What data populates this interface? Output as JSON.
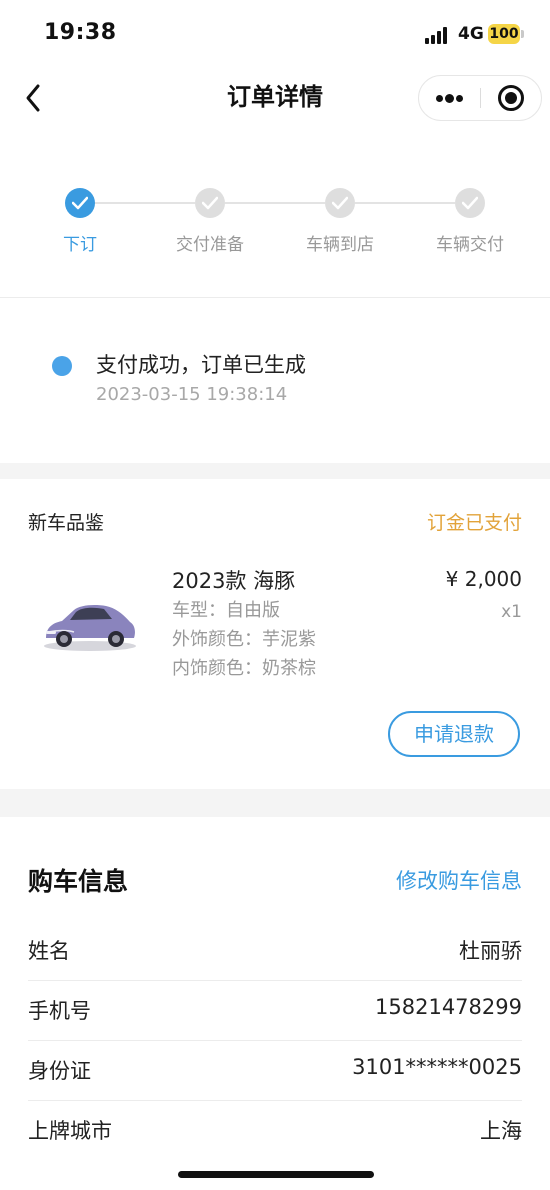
{
  "status_bar": {
    "time": "19:38",
    "network": "4G",
    "battery": "100"
  },
  "nav": {
    "title": "订单详情",
    "back_icon": "chevron-left-icon",
    "more_icon": "more-dots-icon",
    "close_icon": "target-close-icon"
  },
  "steps": [
    {
      "label": "下订",
      "state": "done"
    },
    {
      "label": "交付准备",
      "state": "pending"
    },
    {
      "label": "车辆到店",
      "state": "pending"
    },
    {
      "label": "车辆交付",
      "state": "pending"
    }
  ],
  "order_status": {
    "text": "支付成功，订单已生成",
    "time": "2023-03-15 19:38:14"
  },
  "order_card": {
    "title": "新车品鉴",
    "status": "订金已支付",
    "product_name": "2023款 海豚",
    "model": "车型：自由版",
    "exterior": "外饰颜色：芋泥紫",
    "interior": "内饰颜色：奶茶棕",
    "price": "¥ 2,000",
    "quantity": "x1",
    "refund_button": "申请退款"
  },
  "purchase_info": {
    "title": "购车信息",
    "edit_link": "修改购车信息",
    "rows": [
      {
        "label": "姓名",
        "value": "杜丽骄"
      },
      {
        "label": "手机号",
        "value": "15821478299"
      },
      {
        "label": "身份证",
        "value": "3101******0025"
      },
      {
        "label": "上牌城市",
        "value": "上海"
      }
    ]
  },
  "colors": {
    "accent_blue": "#3a9be0",
    "status_orange": "#e2a33a",
    "car_purple": "#8a84bd"
  }
}
